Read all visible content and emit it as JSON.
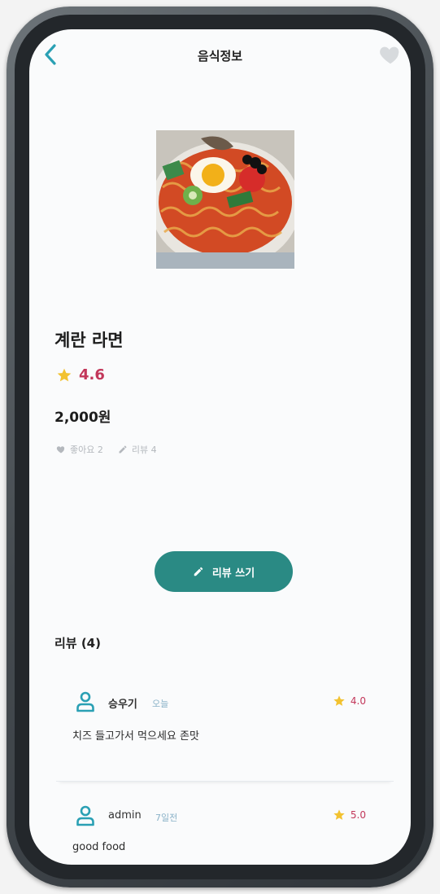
{
  "header": {
    "title": "음식정보",
    "back_icon": "chevron-left-icon",
    "favorite_icon": "heart-icon"
  },
  "food": {
    "image_alt": "계란 라면",
    "name": "계란 라면",
    "rating": "4.6",
    "price": "2,000원",
    "likes_label": "좋아요 2",
    "reviews_label": "리뷰 4"
  },
  "write_review": {
    "label": "리뷰 쓰기",
    "icon": "pencil-icon"
  },
  "reviews": {
    "title": "리뷰 (4)",
    "items": [
      {
        "user": "승우기",
        "date": "오늘",
        "rating": "4.0",
        "text": "치즈 들고가서 먹으세요 존맛"
      },
      {
        "user": "admin",
        "date": "7일전",
        "rating": "5.0",
        "text": "good food"
      }
    ]
  },
  "colors": {
    "accent": "#2a8a84",
    "rating": "#c2375a",
    "star": "#f2c230",
    "icon": "#2aa0b4"
  }
}
